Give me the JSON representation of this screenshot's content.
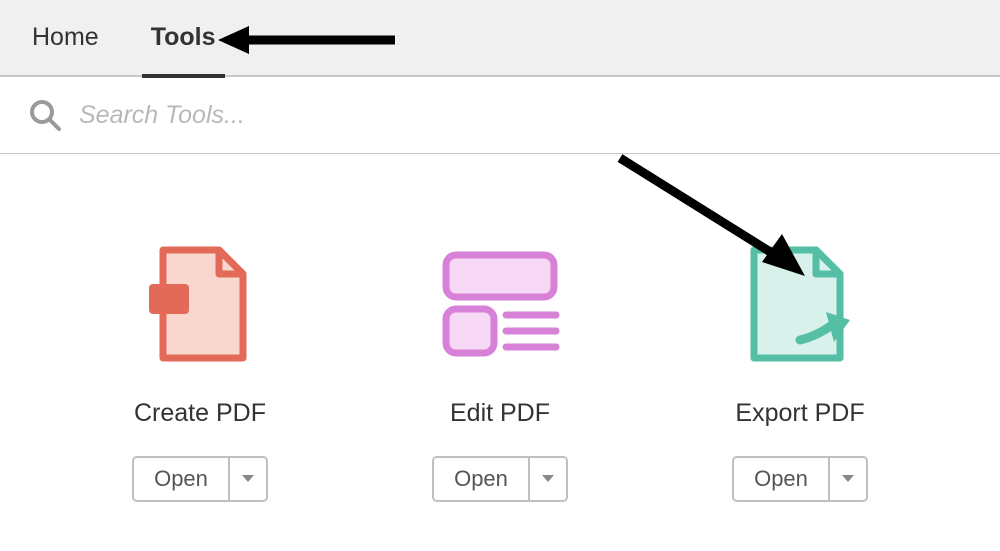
{
  "tabs": {
    "home": "Home",
    "tools": "Tools",
    "active": "tools"
  },
  "search": {
    "placeholder": "Search Tools..."
  },
  "tools": [
    {
      "label": "Create PDF",
      "icon": "create-pdf",
      "action": "Open",
      "color": "#e36a58",
      "fill": "#f9d6ce"
    },
    {
      "label": "Edit PDF",
      "icon": "edit-pdf",
      "action": "Open",
      "color": "#d881d8",
      "fill": "#f7d9f5"
    },
    {
      "label": "Export PDF",
      "icon": "export-pdf",
      "action": "Open",
      "color": "#54bfa4",
      "fill": "#d9f1eb"
    }
  ]
}
